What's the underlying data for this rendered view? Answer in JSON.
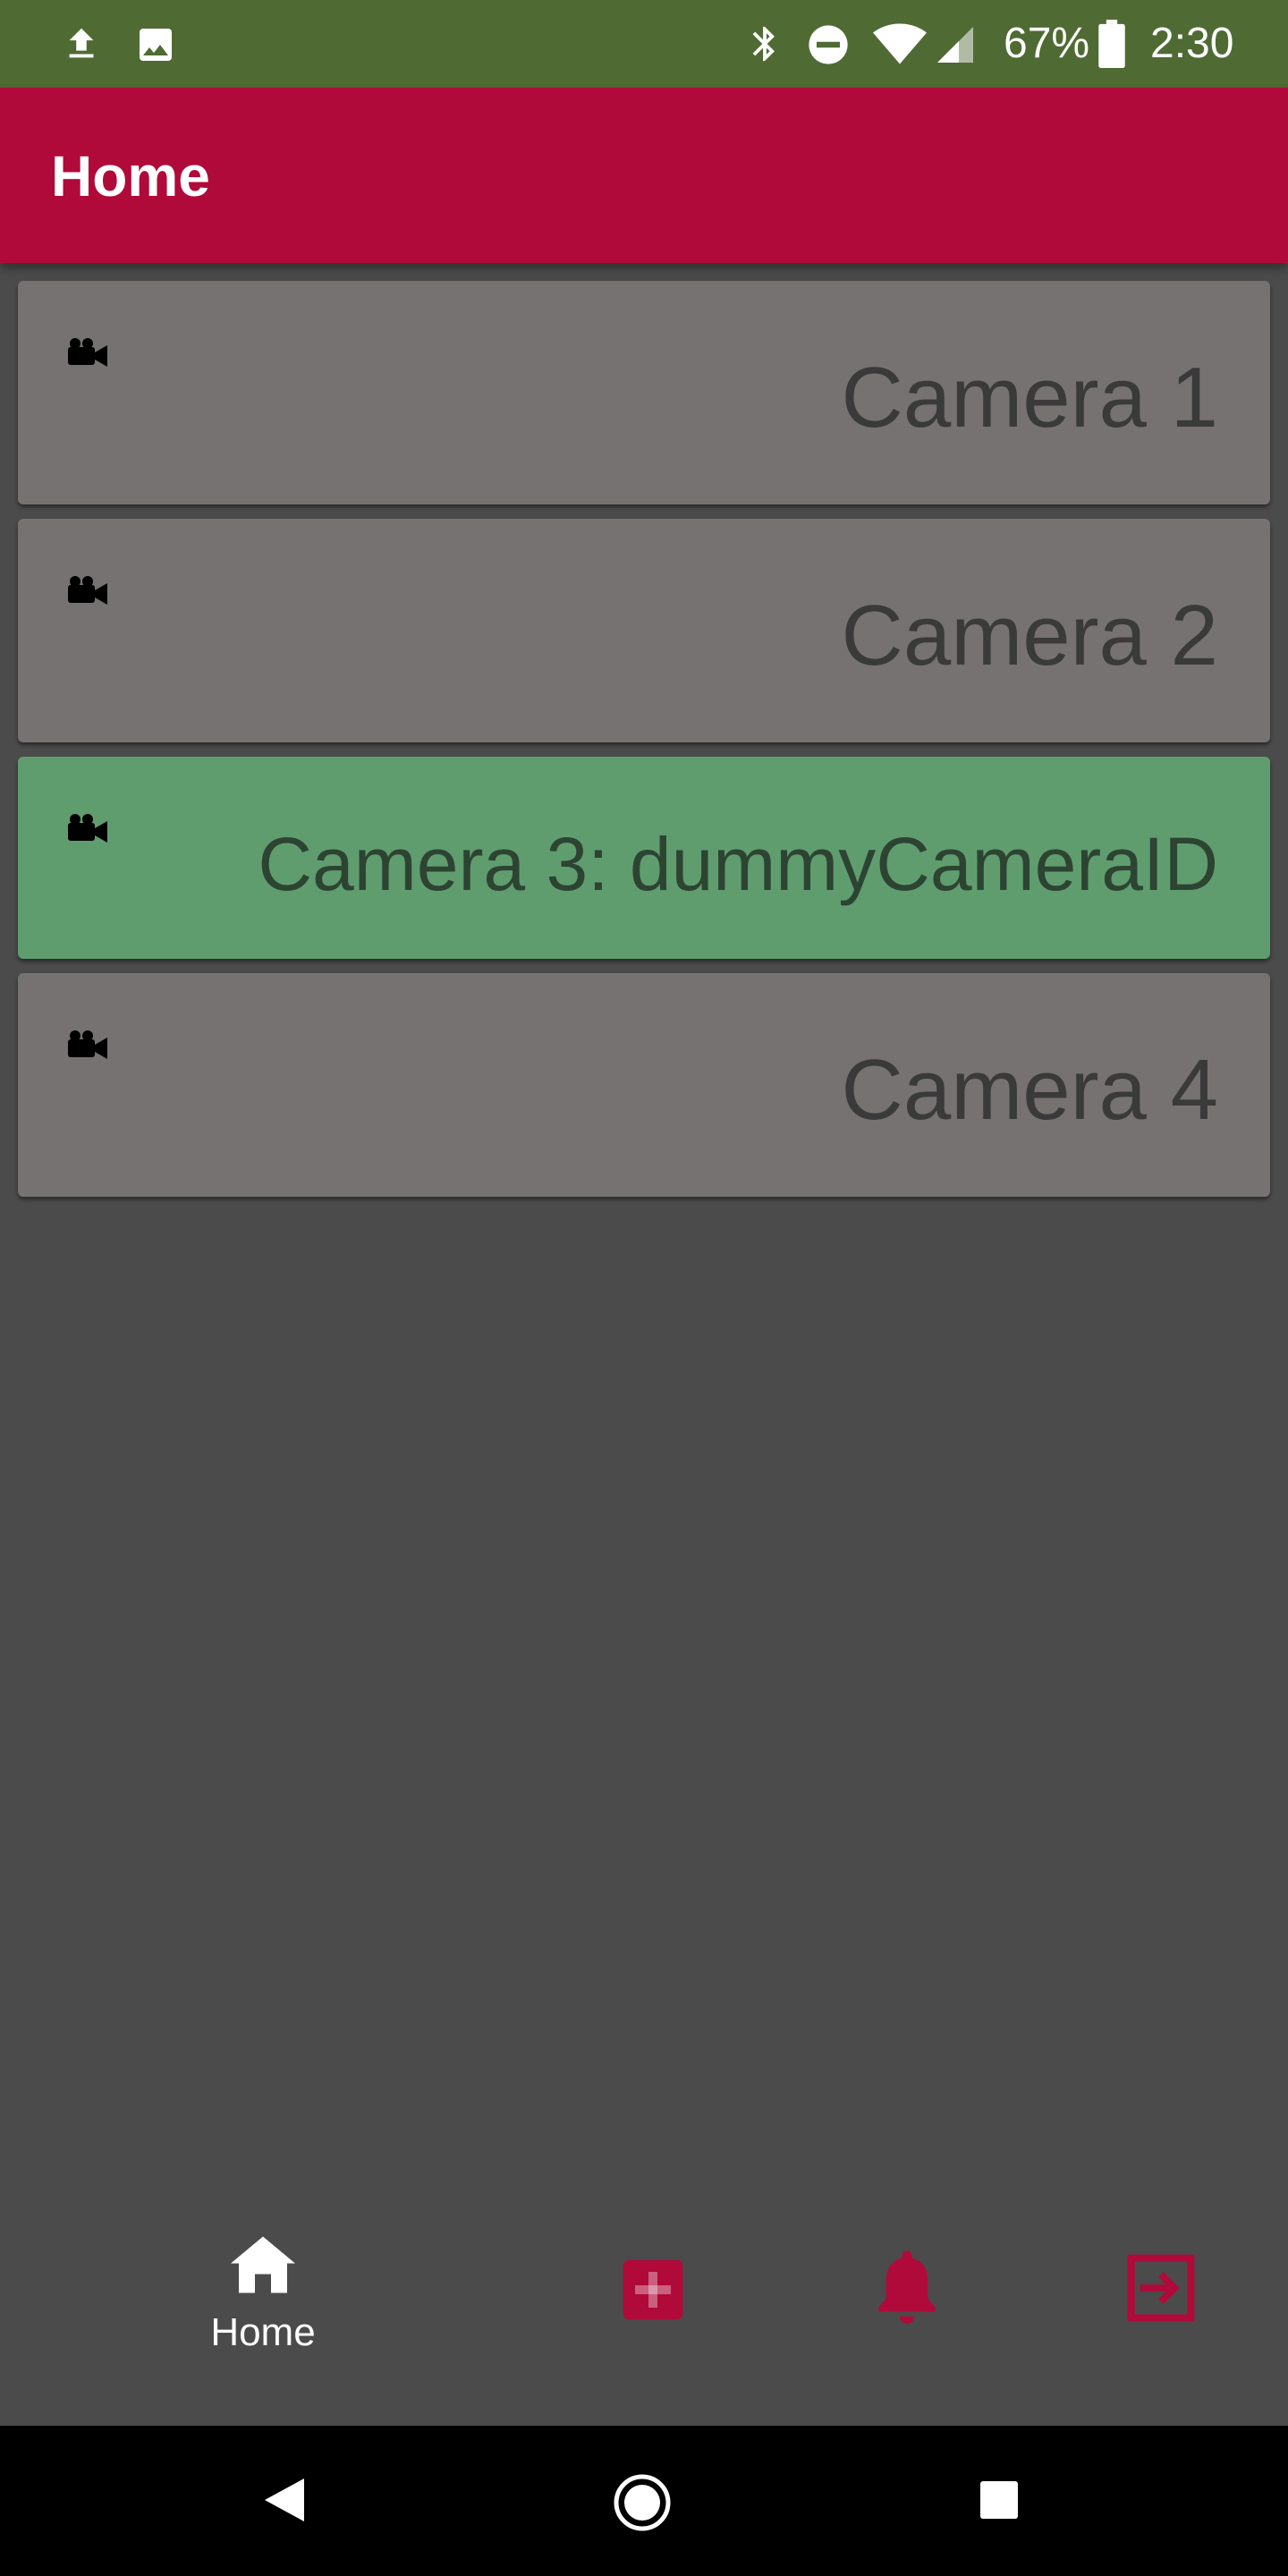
{
  "status_bar": {
    "battery_percent": "67%",
    "time": "2:30",
    "icons": [
      "upload-icon",
      "image-icon",
      "bluetooth-icon",
      "do-not-disturb-icon",
      "wifi-icon",
      "cell-signal-icon",
      "battery-icon"
    ]
  },
  "app_bar": {
    "title": "Home"
  },
  "cameras": [
    {
      "label": "Camera 1",
      "icon": "video-camera-icon",
      "selected": false
    },
    {
      "label": "Camera 2",
      "icon": "video-camera-icon",
      "selected": false
    },
    {
      "label": "Camera 3: dummyCameraID",
      "icon": "video-camera-icon",
      "selected": true
    },
    {
      "label": "Camera 4",
      "icon": "video-camera-icon",
      "selected": false
    }
  ],
  "bottom_nav": {
    "home_label": "Home",
    "items": [
      "home-icon",
      "add-box-icon",
      "bell-icon",
      "exit-icon"
    ]
  },
  "colors": {
    "status_bar": "#4f6b33",
    "app_bar": "#b00a3a",
    "background": "#4b4b4b",
    "card": "#767272",
    "card_selected": "#5f9d6f",
    "accent": "#b00a3a"
  }
}
